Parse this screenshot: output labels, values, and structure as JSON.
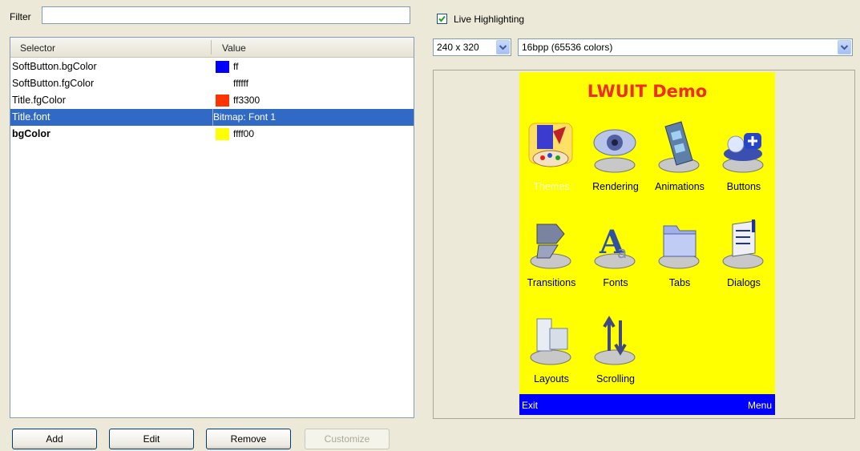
{
  "filter": {
    "label": "Filter",
    "value": ""
  },
  "table": {
    "headers": {
      "selector": "Selector",
      "value": "Value"
    },
    "rows": [
      {
        "selector": "SoftButton.bgColor",
        "value": "ff",
        "swatch": "#0000ff"
      },
      {
        "selector": "SoftButton.fgColor",
        "value": "ffffff",
        "swatch": "#ffffff"
      },
      {
        "selector": "Title.fgColor",
        "value": "ff3300",
        "swatch": "#ff3300"
      },
      {
        "selector": "Title.font",
        "value": "Bitmap: Font 1",
        "swatch": "",
        "selected": true
      },
      {
        "selector": "bgColor",
        "value": "ffff00",
        "swatch": "#ffff00",
        "bold": true
      }
    ]
  },
  "buttons": {
    "add": "Add",
    "edit": "Edit",
    "remove": "Remove",
    "customize": "Customize"
  },
  "preview": {
    "live_highlighting": {
      "label": "Live Highlighting",
      "checked": true
    },
    "resolution": "240 x 320",
    "color_depth": "16bpp (65536 colors)",
    "phone": {
      "title": "LWUIT Demo",
      "apps": [
        {
          "label": "Themes",
          "icon": "themes-icon"
        },
        {
          "label": "Rendering",
          "icon": "rendering-icon"
        },
        {
          "label": "Animations",
          "icon": "animations-icon"
        },
        {
          "label": "Buttons",
          "icon": "buttons-icon"
        },
        {
          "label": "Transitions",
          "icon": "transitions-icon"
        },
        {
          "label": "Fonts",
          "icon": "fonts-icon"
        },
        {
          "label": "Tabs",
          "icon": "tabs-icon"
        },
        {
          "label": "Dialogs",
          "icon": "dialogs-icon"
        },
        {
          "label": "Layouts",
          "icon": "layouts-icon"
        },
        {
          "label": "Scrolling",
          "icon": "scrolling-icon"
        }
      ],
      "softkeys": {
        "left": "Exit",
        "right": "Menu"
      },
      "colors": {
        "background": "#ffff00",
        "title": "#ff3300",
        "softbar": "#0000ff"
      }
    }
  }
}
